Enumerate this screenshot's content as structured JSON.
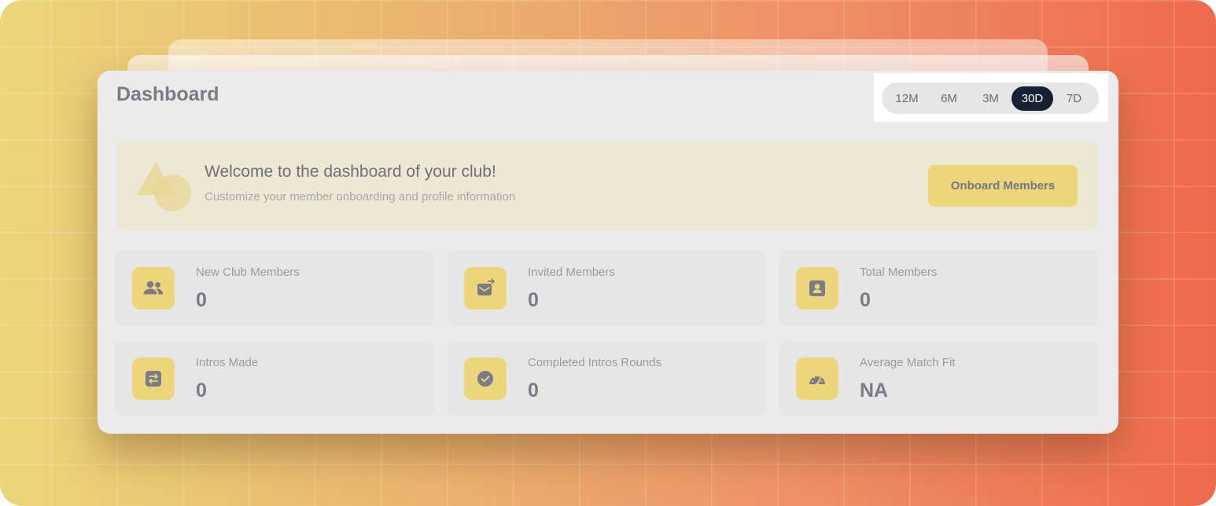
{
  "dashboard": {
    "title": "Dashboard"
  },
  "time_range": {
    "options": [
      "12M",
      "6M",
      "3M",
      "30D",
      "7D"
    ],
    "selected": "30D"
  },
  "welcome": {
    "title": "Welcome to the dashboard of your club!",
    "subtitle": "Customize your member onboarding and profile information",
    "button_label": "Onboard Members"
  },
  "stats": [
    {
      "label": "New Club Members",
      "value": "0",
      "icon": "users-icon"
    },
    {
      "label": "Invited Members",
      "value": "0",
      "icon": "mail-forward-icon"
    },
    {
      "label": "Total Members",
      "value": "0",
      "icon": "contact-card-icon"
    },
    {
      "label": "Intros Made",
      "value": "0",
      "icon": "swap-arrows-icon"
    },
    {
      "label": "Completed Intros Rounds",
      "value": "0",
      "icon": "check-circle-icon"
    },
    {
      "label": "Average Match Fit",
      "value": "NA",
      "icon": "gauge-icon"
    }
  ],
  "colors": {
    "accent": "#ecd57b",
    "active_range": "#182033",
    "card_bg": "#ebebeb",
    "icon_fg": "#7a7b86"
  }
}
